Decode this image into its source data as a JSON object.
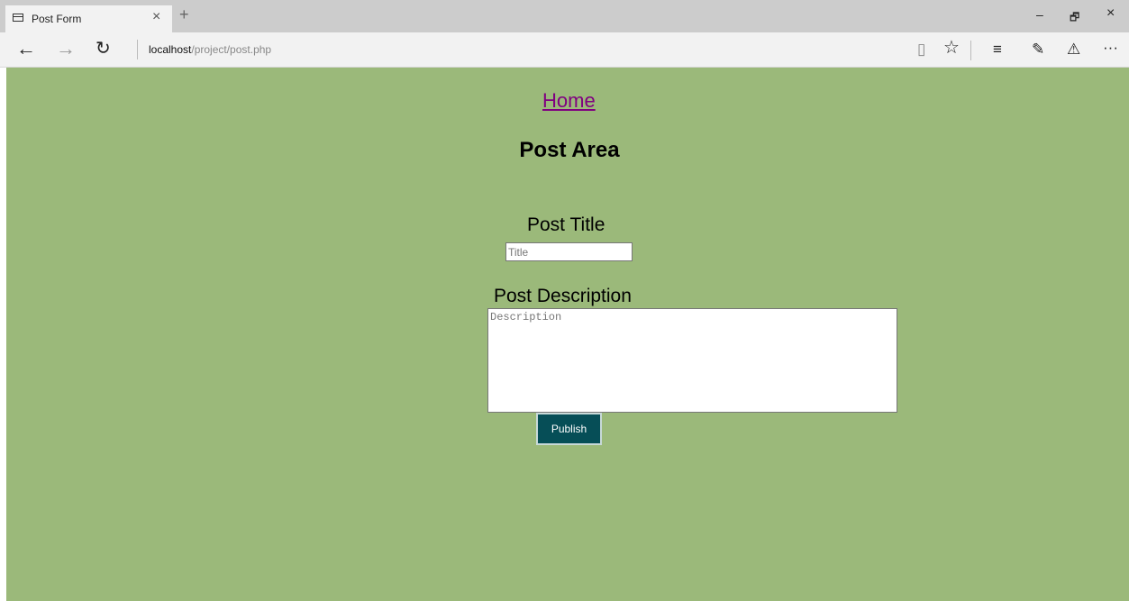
{
  "browser": {
    "tab_title": "Post Form",
    "tab_close": "×",
    "new_tab": "+",
    "window_controls": {
      "minimize": "–",
      "restore": "🗗",
      "close": "×"
    },
    "nav": {
      "back": "←",
      "forward": "→",
      "refresh": "↻"
    },
    "url": {
      "host": "localhost",
      "path": "/project/post.php"
    },
    "toolbar_icons": [
      "reading-view-icon",
      "favorite-star-icon",
      "hub-icon",
      "web-note-icon",
      "share-icon",
      "more-icon"
    ],
    "toolbar_glyphs": {
      "reading": "▯",
      "star": "☆",
      "hub": "≡",
      "note": "✎",
      "share": "⚠",
      "more": "···"
    }
  },
  "page": {
    "background": "#9bb97a",
    "home_link": "Home",
    "heading": "Post Area",
    "title_label": "Post Title",
    "title_placeholder": "Title",
    "description_label": "Post Description",
    "description_placeholder": "Description",
    "publish_label": "Publish",
    "publish_color": "#064e57"
  }
}
